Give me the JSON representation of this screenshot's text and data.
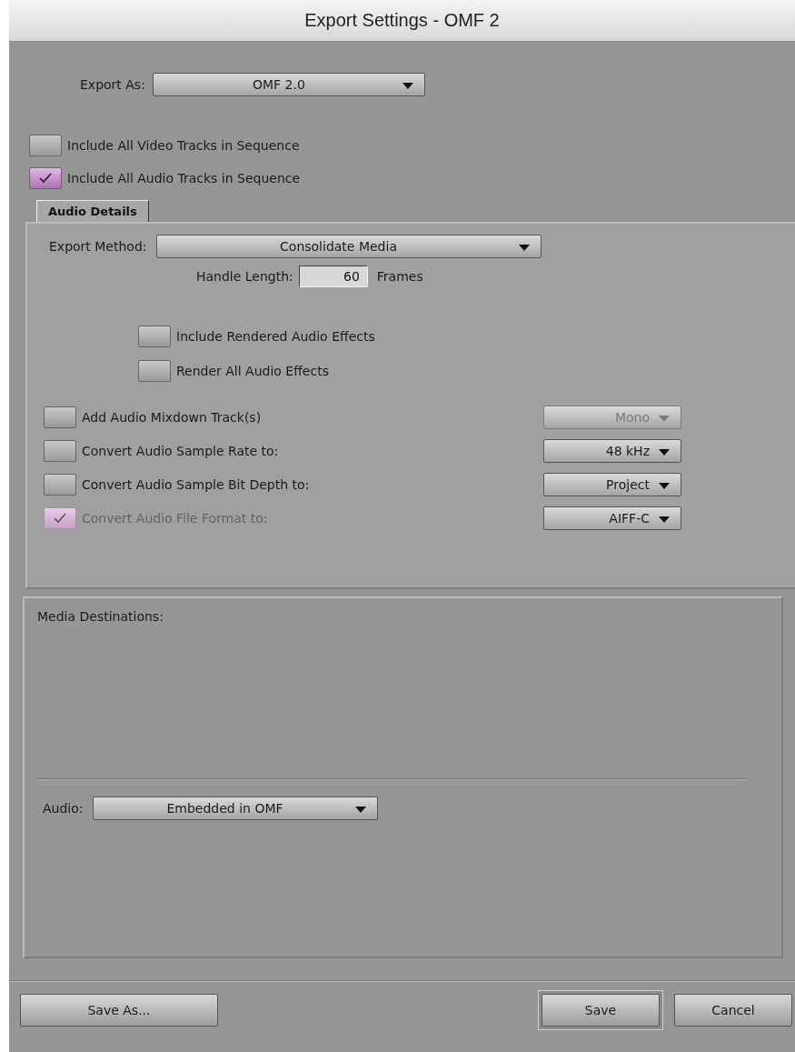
{
  "window": {
    "title": "Export Settings - OMF 2"
  },
  "export_as": {
    "label": "Export As:",
    "value": "OMF 2.0"
  },
  "track_options": [
    {
      "label": "Include All Video Tracks in Sequence",
      "checked": false
    },
    {
      "label": "Include All Audio Tracks in Sequence",
      "checked": true
    }
  ],
  "tabs": [
    {
      "label": "Audio Details",
      "selected": true
    }
  ],
  "audio_details": {
    "export_method": {
      "label": "Export Method:",
      "value": "Consolidate Media"
    },
    "handle_length": {
      "label": "Handle Length:",
      "value": "60",
      "unit": "Frames"
    },
    "effects": [
      {
        "label": "Include Rendered Audio Effects",
        "checked": false
      },
      {
        "label": "Render All Audio Effects",
        "checked": false
      }
    ],
    "conversions": [
      {
        "label": "Add Audio Mixdown Track(s)",
        "checked": false,
        "disabled": false,
        "value": "Mono",
        "menu_disabled": true
      },
      {
        "label": "Convert Audio Sample Rate to:",
        "checked": false,
        "disabled": false,
        "value": "48 kHz",
        "menu_disabled": false
      },
      {
        "label": "Convert Audio Sample Bit Depth to:",
        "checked": false,
        "disabled": false,
        "value": "Project",
        "menu_disabled": false
      },
      {
        "label": "Convert Audio File Format to:",
        "checked": true,
        "disabled": true,
        "value": "AIFF-C",
        "menu_disabled": false
      }
    ]
  },
  "media_destinations": {
    "title": "Media Destinations:",
    "audio": {
      "label": "Audio:",
      "value": "Embedded in OMF"
    }
  },
  "buttons": [
    {
      "label": "Save As...",
      "kind": "plain"
    },
    {
      "label": "Save",
      "kind": "default"
    },
    {
      "label": "Cancel",
      "kind": "plain"
    }
  ]
}
